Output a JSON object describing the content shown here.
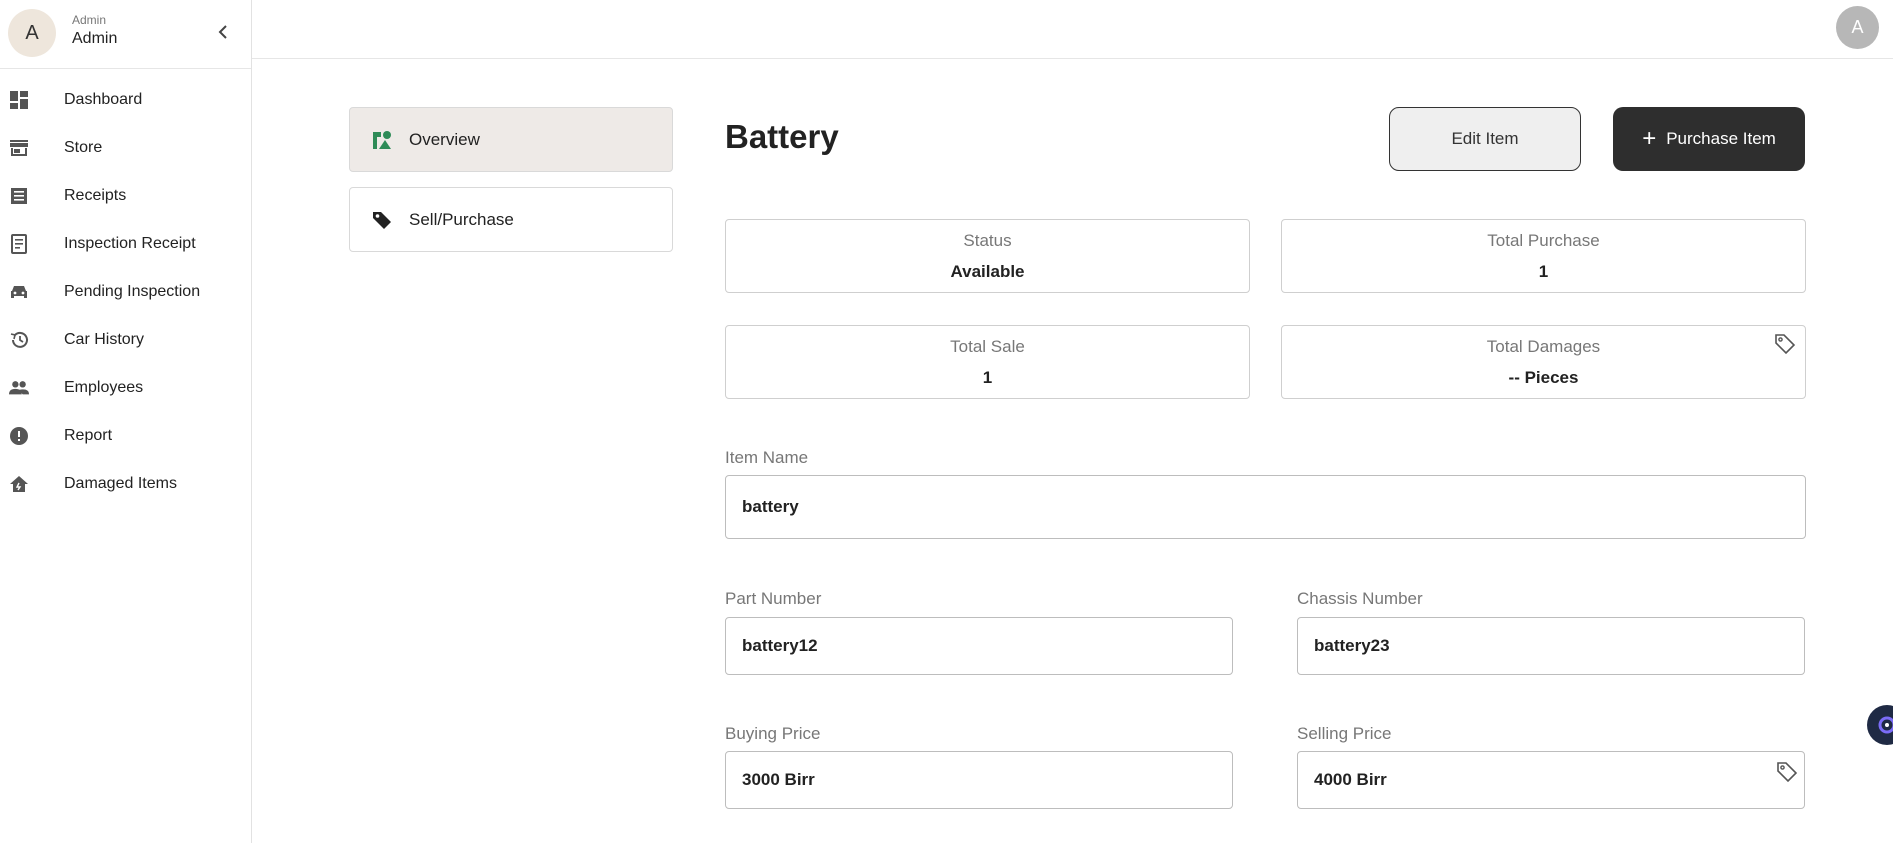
{
  "sidebar": {
    "avatar_initial": "A",
    "role": "Admin",
    "name": "Admin",
    "items": [
      {
        "label": "Dashboard",
        "icon": "dashboard-icon"
      },
      {
        "label": "Store",
        "icon": "store-icon"
      },
      {
        "label": "Receipts",
        "icon": "receipt-icon"
      },
      {
        "label": "Inspection Receipt",
        "icon": "inspection-receipt-icon"
      },
      {
        "label": "Pending Inspection",
        "icon": "car-icon"
      },
      {
        "label": "Car History",
        "icon": "history-icon"
      },
      {
        "label": "Employees",
        "icon": "people-icon"
      },
      {
        "label": "Report",
        "icon": "alert-icon"
      },
      {
        "label": "Damaged Items",
        "icon": "home-damage-icon"
      }
    ]
  },
  "topbar": {
    "avatar_initial": "A"
  },
  "submenu": {
    "overview": "Overview",
    "sell_purchase": "Sell/Purchase"
  },
  "item": {
    "title": "Battery",
    "edit_label": "Edit Item",
    "purchase_label": "Purchase Item"
  },
  "stats": {
    "status_label": "Status",
    "status_value": "Available",
    "total_purchase_label": "Total Purchase",
    "total_purchase_value": "1",
    "total_sale_label": "Total Sale",
    "total_sale_value": "1",
    "total_damages_label": "Total Damages",
    "total_damages_value": "-- Pieces"
  },
  "form": {
    "item_name_label": "Item Name",
    "item_name_value": "battery",
    "part_number_label": "Part Number",
    "part_number_value": "battery12",
    "chassis_number_label": "Chassis Number",
    "chassis_number_value": "battery23",
    "buying_price_label": "Buying Price",
    "buying_price_value": "3000 Birr",
    "selling_price_label": "Selling Price",
    "selling_price_value": "4000 Birr"
  },
  "colors": {
    "accent_green": "#2e8b57",
    "dark_button": "#2e2e2e",
    "logout_red": "#dd2222"
  }
}
